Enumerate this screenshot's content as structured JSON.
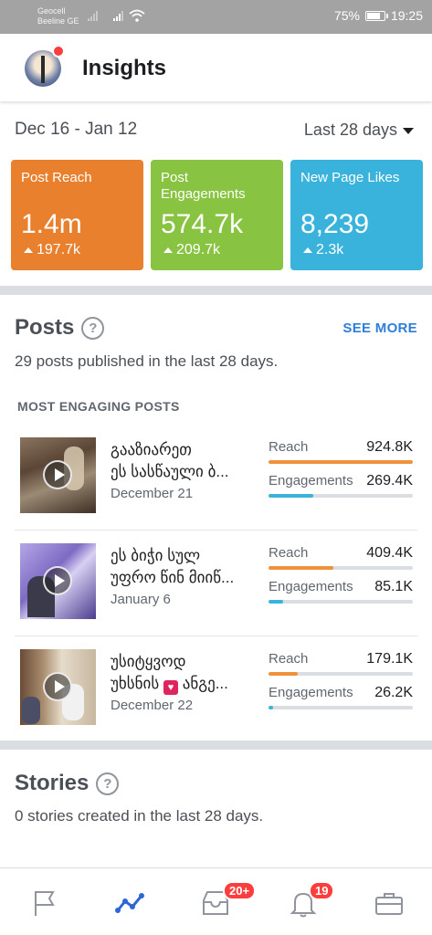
{
  "status_bar": {
    "carrier1": "Geocell",
    "carrier2": "Beeline GE",
    "battery": "75%",
    "time": "19:25"
  },
  "header": {
    "title": "Insights"
  },
  "date_range": {
    "label": "Dec 16 - Jan 12",
    "selector": "Last 28 days"
  },
  "cards": [
    {
      "label": "Post Reach",
      "value": "1.4m",
      "delta": "197.7k",
      "color": "#e8802e"
    },
    {
      "label": "Post Engagements",
      "value": "574.7k",
      "delta": "209.7k",
      "color": "#88c342"
    },
    {
      "label": "New Page Likes",
      "value": "8,239",
      "delta": "2.3k",
      "color": "#3ab3dc"
    }
  ],
  "posts": {
    "title": "Posts",
    "see_more": "SEE MORE",
    "subtitle": "29 posts published in the last 28 days.",
    "section_label": "MOST ENGAGING POSTS",
    "reach_label": "Reach",
    "engagements_label": "Engagements",
    "items": [
      {
        "line1": "გააზიარეთ",
        "line2": "ეს სასწაული ბ...",
        "date": "December 21",
        "reach": "924.8K",
        "engagements": "269.4K",
        "reach_fraction": 1.0,
        "engagements_fraction": 0.31
      },
      {
        "line1": "ეს ბიჭი სულ",
        "line2": "უფრო წინ მიიწ...",
        "date": "January 6",
        "reach": "409.4K",
        "engagements": "85.1K",
        "reach_fraction": 0.45,
        "engagements_fraction": 0.1
      },
      {
        "line1": "უსიტყვოდ",
        "line2_a": "უხსნის",
        "line2_b": "ანგე...",
        "date": "December 22",
        "reach": "179.1K",
        "engagements": "26.2K",
        "reach_fraction": 0.2,
        "engagements_fraction": 0.03
      }
    ]
  },
  "stories": {
    "title": "Stories",
    "subtitle": "0 stories created in the last 28 days."
  },
  "bottom_nav": {
    "inbox_badge": "20+",
    "notifications_badge": "19"
  },
  "colors": {
    "reach_bar": "#f0913c",
    "engagement_bar": "#3ab3dc",
    "accent_blue": "#2f7ed8",
    "badge_red": "#fa3e3e"
  }
}
